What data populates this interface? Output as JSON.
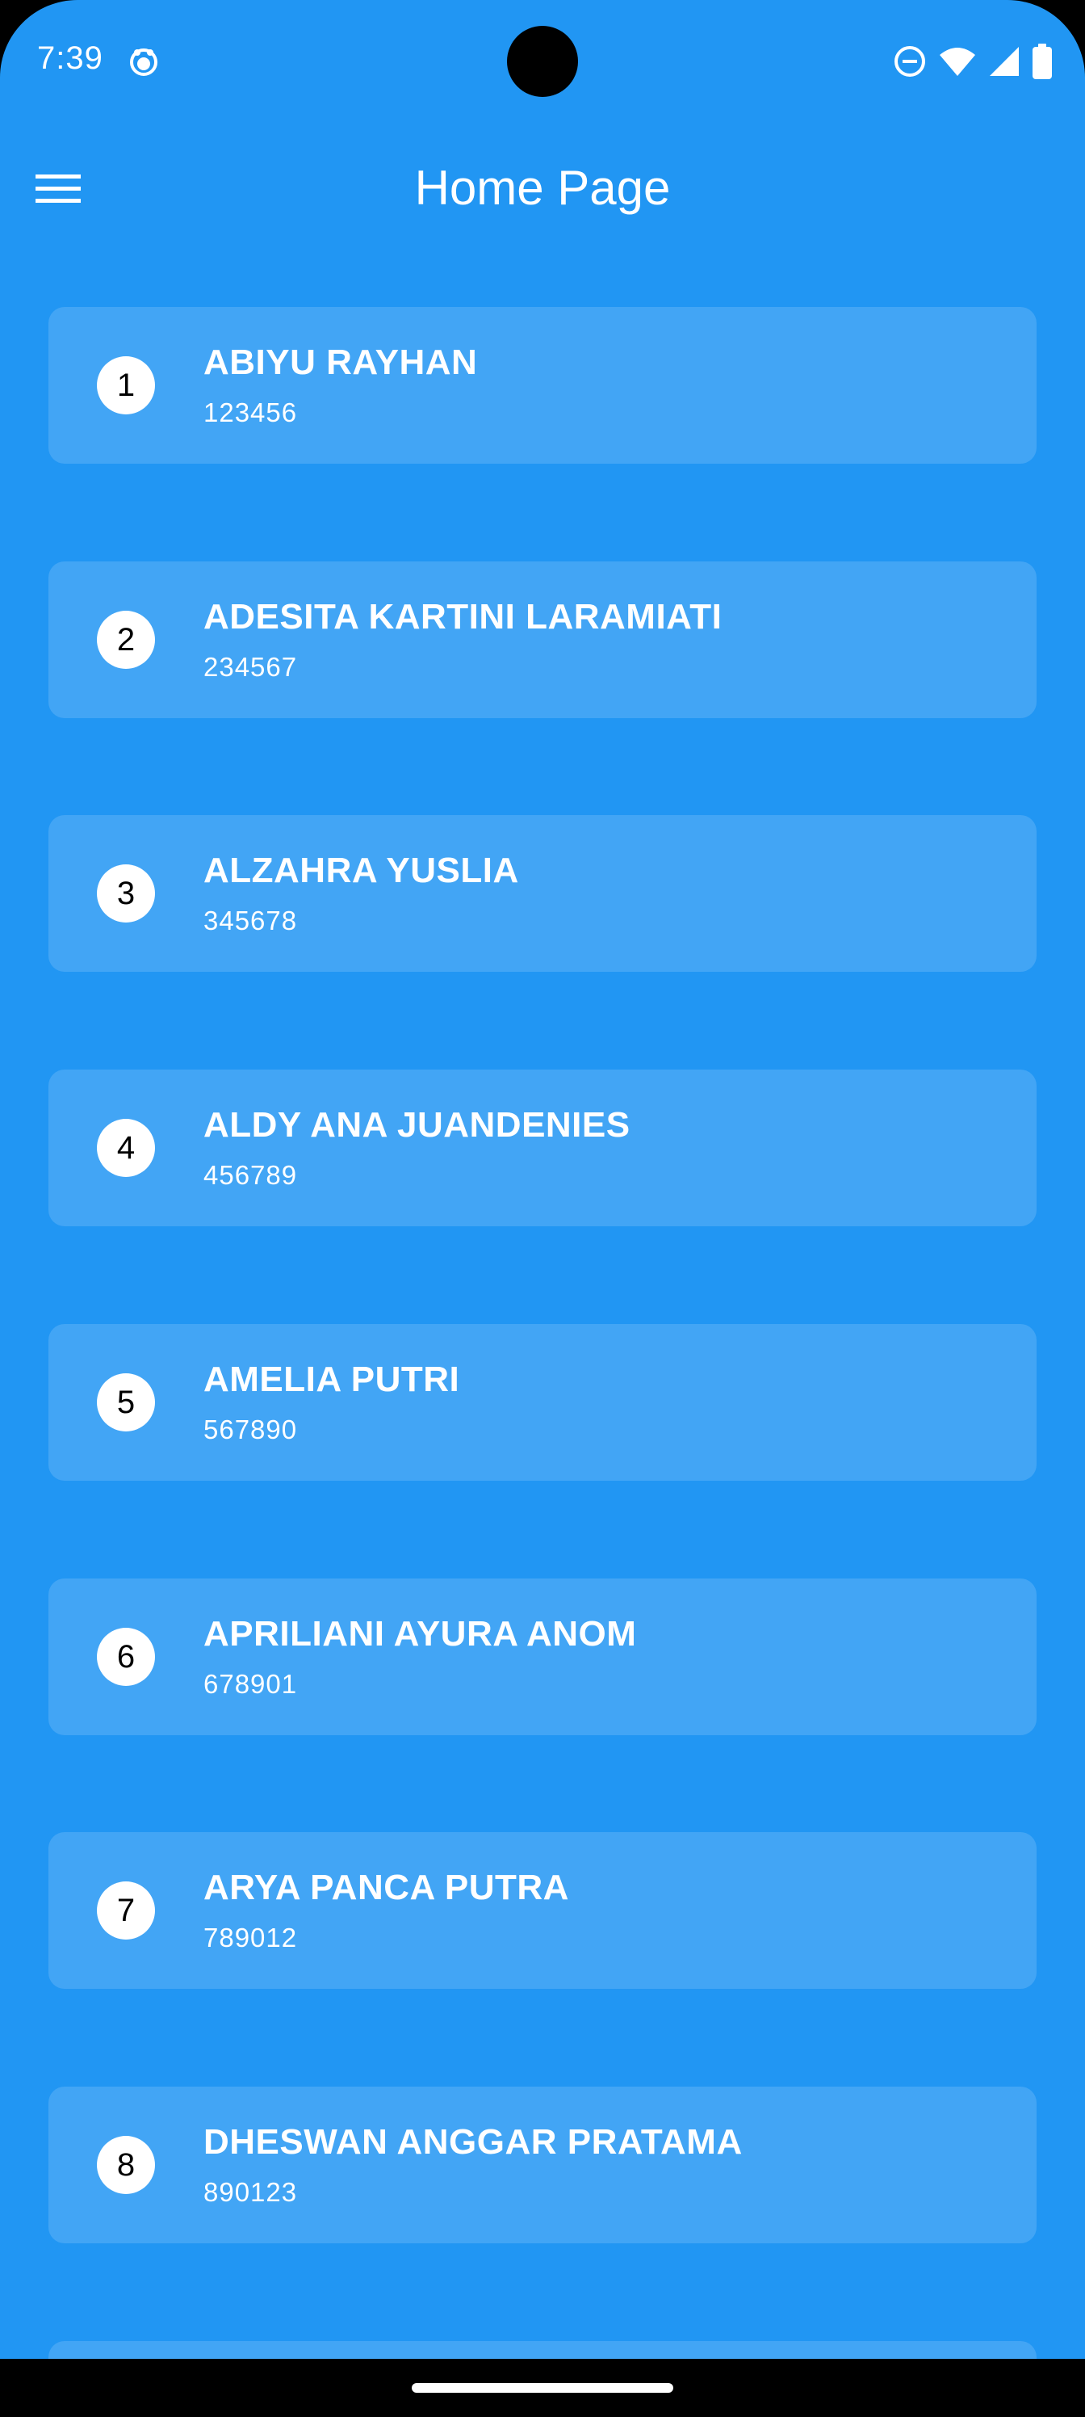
{
  "status_bar": {
    "time": "7:39"
  },
  "app_bar": {
    "title": "Home Page"
  },
  "students": [
    {
      "number": "1",
      "name": "ABIYU RAYHAN",
      "id": "123456"
    },
    {
      "number": "2",
      "name": "ADESITA KARTINI LARAMIATI",
      "id": "234567"
    },
    {
      "number": "3",
      "name": "ALZAHRA YUSLIA",
      "id": "345678"
    },
    {
      "number": "4",
      "name": "ALDY ANA JUANDENIES",
      "id": "456789"
    },
    {
      "number": "5",
      "name": "AMELIA PUTRI",
      "id": "567890"
    },
    {
      "number": "6",
      "name": "APRILIANI AYURA ANOM",
      "id": "678901"
    },
    {
      "number": "7",
      "name": "ARYA PANCA PUTRA",
      "id": "789012"
    },
    {
      "number": "8",
      "name": "DHESWAN ANGGAR PRATAMA",
      "id": "890123"
    }
  ],
  "colors": {
    "primary": "#2196F3",
    "card": "#42A5F5",
    "avatar": "#FFFFFF"
  },
  "icons": {
    "menu": "hamburger-menu-icon",
    "status_app": "app-notification-icon",
    "dnd": "do-not-disturb-icon",
    "wifi": "wifi-icon",
    "signal": "cell-signal-icon",
    "battery": "battery-icon"
  }
}
